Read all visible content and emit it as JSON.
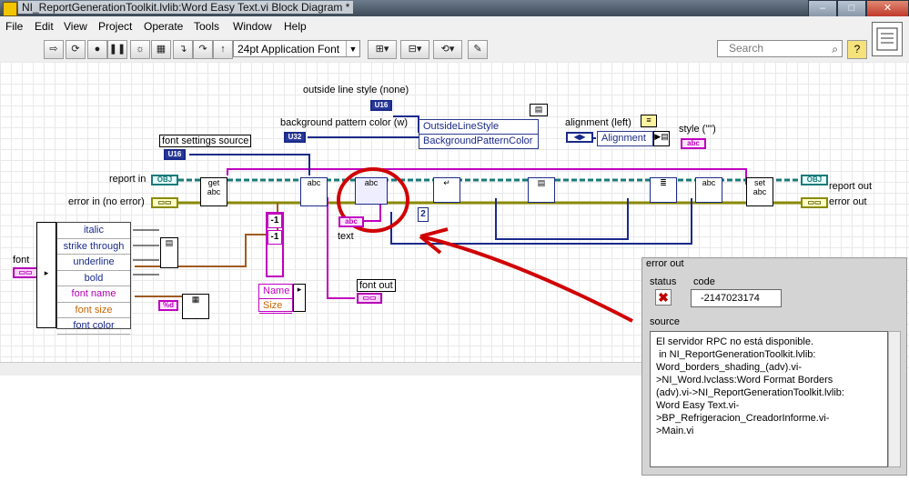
{
  "window": {
    "title": "NI_ReportGenerationToolkit.lvlib:Word Easy Text.vi Block Diagram *",
    "minimize": "–",
    "maximize": "□",
    "close": "✕"
  },
  "menu": [
    "File",
    "Edit",
    "View",
    "Project",
    "Operate",
    "Tools",
    "Window",
    "Help"
  ],
  "toolbar": {
    "font": "24pt Application Font",
    "search_placeholder": "Search",
    "help": "?"
  },
  "diagram": {
    "outside_line_style_label": "outside line style (none)",
    "background_pattern_label": "background pattern color (w)",
    "font_settings_source_label": "font settings source",
    "alignment_label": "alignment (left)",
    "style_label": "style (\"\")",
    "report_in_label": "report in",
    "error_in_label": "error in (no error)",
    "report_out_label": "report out",
    "error_out_label": "error out",
    "font_label": "font",
    "text_label": "text",
    "font_out_label": "font out",
    "prop1": [
      "OutsideLineStyle",
      "BackgroundPatternColor"
    ],
    "prop_alignment": "Alignment",
    "prop_font": [
      "Name",
      "Size"
    ],
    "get_label": "get",
    "set_label": "set",
    "abc": "abc",
    "const_2": "2",
    "const_neg1_a": "-1",
    "const_neg1_b": "-1",
    "format_d": "%d",
    "unbundle": [
      "italic",
      "strike through",
      "underline",
      "bold",
      "font name",
      "font size",
      "font color"
    ]
  },
  "error_cluster": {
    "title": "error out",
    "status_label": "status",
    "code_label": "code",
    "code_value": "-2147023174",
    "source_label": "source",
    "source_text": "El servidor RPC no está disponible.\n in NI_ReportGenerationToolkit.lvlib:\nWord_borders_shading_(adv).vi-\n>NI_Word.lvclass:Word Format Borders\n(adv).vi->NI_ReportGenerationToolkit.lvlib:\nWord Easy Text.vi-\n>BP_Refrigeracion_CreadorInforme.vi-\n>Main.vi"
  }
}
